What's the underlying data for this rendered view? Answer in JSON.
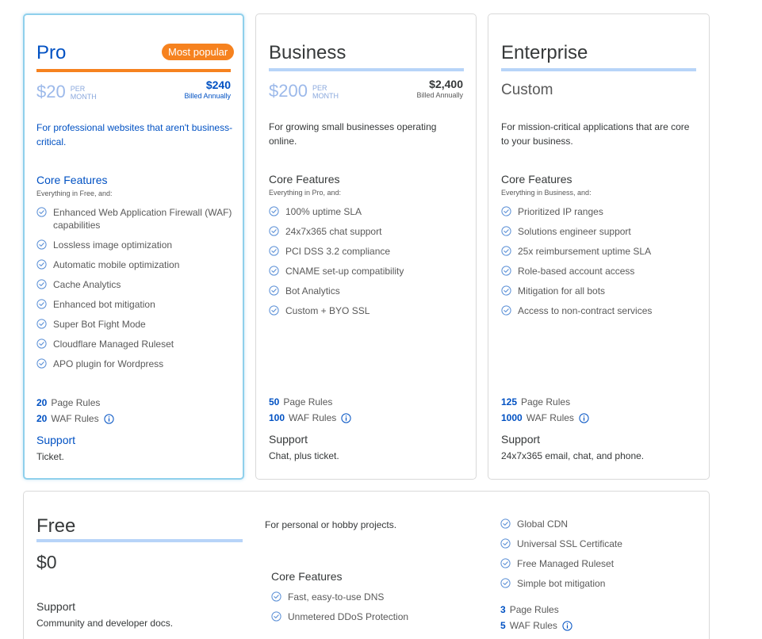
{
  "plans": {
    "pro": {
      "name": "Pro",
      "badge": "Most popular",
      "price": "$20",
      "per_line1": "PER",
      "per_line2": "MONTH",
      "annual_price": "$240",
      "annual_note": "Billed Annually",
      "description": "For professional websites that aren't business-critical.",
      "core_title": "Core Features",
      "core_sub": "Everything in Free, and:",
      "features": [
        "Enhanced Web Application Firewall (WAF) capabilities",
        "Lossless image optimization",
        "Automatic mobile optimization",
        "Cache Analytics",
        "Enhanced bot mitigation",
        "Super Bot Fight Mode",
        "Cloudflare Managed Ruleset",
        "APO plugin for Wordpress"
      ],
      "page_rules_num": "20",
      "page_rules_label": "Page Rules",
      "waf_rules_num": "20",
      "waf_rules_label": "WAF Rules",
      "support_title": "Support",
      "support_text": "Ticket."
    },
    "business": {
      "name": "Business",
      "price": "$200",
      "per_line1": "PER",
      "per_line2": "MONTH",
      "annual_price": "$2,400",
      "annual_note": "Billed Annually",
      "description": "For growing small businesses operating online.",
      "core_title": "Core Features",
      "core_sub": "Everything in Pro, and:",
      "features": [
        "100% uptime SLA",
        "24x7x365 chat support",
        "PCI DSS 3.2 compliance",
        "CNAME set-up compatibility",
        "Bot Analytics",
        "Custom + BYO SSL"
      ],
      "page_rules_num": "50",
      "page_rules_label": "Page Rules",
      "waf_rules_num": "100",
      "waf_rules_label": "WAF Rules",
      "support_title": "Support",
      "support_text": "Chat, plus ticket."
    },
    "enterprise": {
      "name": "Enterprise",
      "price": "Custom",
      "description": "For mission-critical applications that are core to your business.",
      "core_title": "Core Features",
      "core_sub": "Everything in Business, and:",
      "features": [
        "Prioritized IP ranges",
        "Solutions engineer support",
        "25x reimbursement uptime SLA",
        "Role-based account access",
        "Mitigation for all bots",
        "Access to non-contract services"
      ],
      "page_rules_num": "125",
      "page_rules_label": "Page Rules",
      "waf_rules_num": "1000",
      "waf_rules_label": "WAF Rules",
      "support_title": "Support",
      "support_text": "24x7x365 email, chat, and phone."
    },
    "free": {
      "name": "Free",
      "price": "$0",
      "description": "For personal or hobby projects.",
      "core_title": "Core Features",
      "core_features": [
        "Fast, easy-to-use DNS",
        "Unmetered DDoS Protection"
      ],
      "features": [
        "Global CDN",
        "Universal SSL Certificate",
        "Free Managed Ruleset",
        "Simple bot mitigation"
      ],
      "page_rules_num": "3",
      "page_rules_label": "Page Rules",
      "waf_rules_num": "5",
      "waf_rules_label": "WAF Rules",
      "support_title": "Support",
      "support_text": "Community and developer docs."
    }
  },
  "icons": {
    "feature": "check-circle-icon",
    "info": "info-circle-icon"
  },
  "colors": {
    "brand_blue": "#0051c3",
    "accent_orange": "#f6821f",
    "price_blue": "#9cb9ea",
    "check_blue": "#5a8fd6",
    "rule_blue": "#b7d4f8"
  }
}
